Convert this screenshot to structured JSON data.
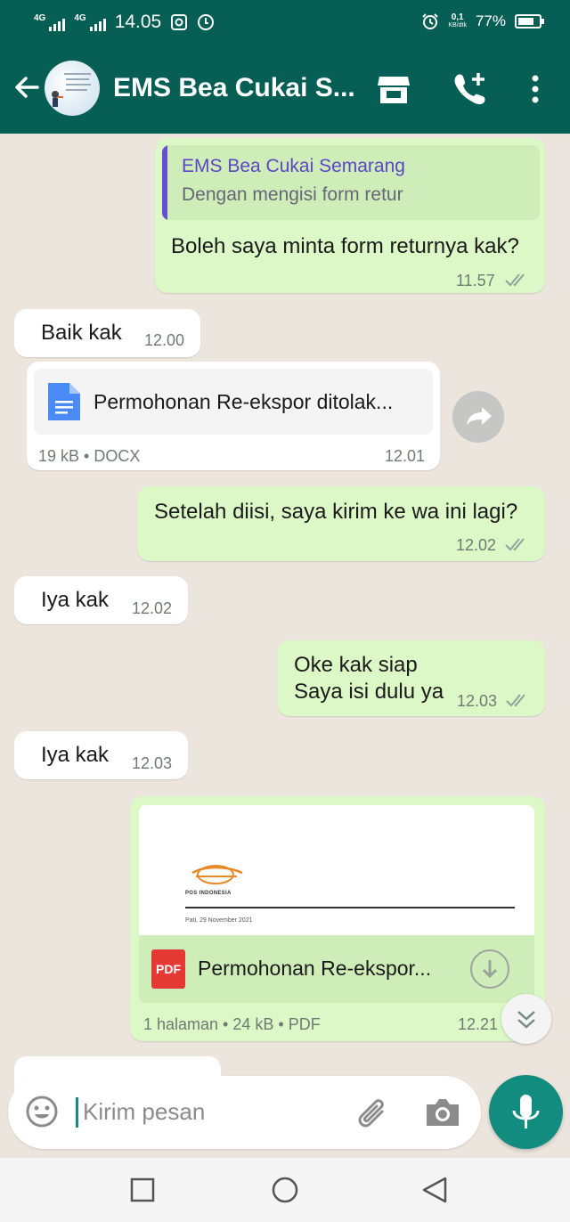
{
  "status_bar": {
    "network_1": "4G",
    "network_2": "4G",
    "time": "14.05",
    "speed_value": "0,1",
    "speed_unit": "KB/dtk",
    "battery": "77%",
    "battery_level": 0.77,
    "icons": [
      "signal-icon",
      "gallery-icon",
      "data-saver-icon",
      "alarm-icon",
      "battery-icon"
    ]
  },
  "header": {
    "title": "EMS Bea Cukai S...",
    "icons": [
      "back-arrow-icon",
      "storefront-icon",
      "add-call-icon",
      "more-vertical-icon"
    ],
    "bar_color": "#075e54"
  },
  "messages": [
    {
      "direction": "out",
      "quote_author": "EMS Bea Cukai Semarang",
      "quote_text": "Dengan mengisi form retur",
      "text": "Boleh saya minta form returnya kak?",
      "time": "11.57",
      "status": "read"
    },
    {
      "direction": "in",
      "text": "Baik kak",
      "time": "12.00"
    },
    {
      "direction": "in",
      "type": "document",
      "file_name": "Permohonan Re-ekspor ditolak...",
      "file_meta": "19 kB • DOCX",
      "time": "12.01"
    },
    {
      "direction": "out",
      "text": "Setelah diisi, saya kirim ke wa ini lagi?",
      "time": "12.02",
      "status": "read"
    },
    {
      "direction": "in",
      "text": "Iya kak",
      "time": "12.02"
    },
    {
      "direction": "out",
      "lines": [
        "Oke kak siap",
        "Saya isi dulu ya"
      ],
      "time": "12.03",
      "status": "read"
    },
    {
      "direction": "in",
      "text": "Iya kak",
      "time": "12.03"
    },
    {
      "direction": "out",
      "type": "pdf",
      "preview_org": "POS INDONESIA",
      "preview_date": "Pati, 29 November 2021",
      "badge": "PDF",
      "file_name": "Permohonan Re-ekspor...",
      "file_meta": "1 halaman • 24 kB • PDF",
      "time": "12.21"
    }
  ],
  "composer": {
    "placeholder": "Kirim pesan",
    "icons": [
      "emoji-icon",
      "attach-icon",
      "camera-icon",
      "mic-icon"
    ]
  },
  "nav": {
    "icons": [
      "recent-apps-icon",
      "home-icon",
      "back-icon"
    ]
  },
  "colors": {
    "outgoing_bubble": "#dcf8c6",
    "incoming_bubble": "#ffffff",
    "chat_background": "#ece5dd",
    "read_ticks": "#8fa39a",
    "accent": "#128c7e"
  }
}
